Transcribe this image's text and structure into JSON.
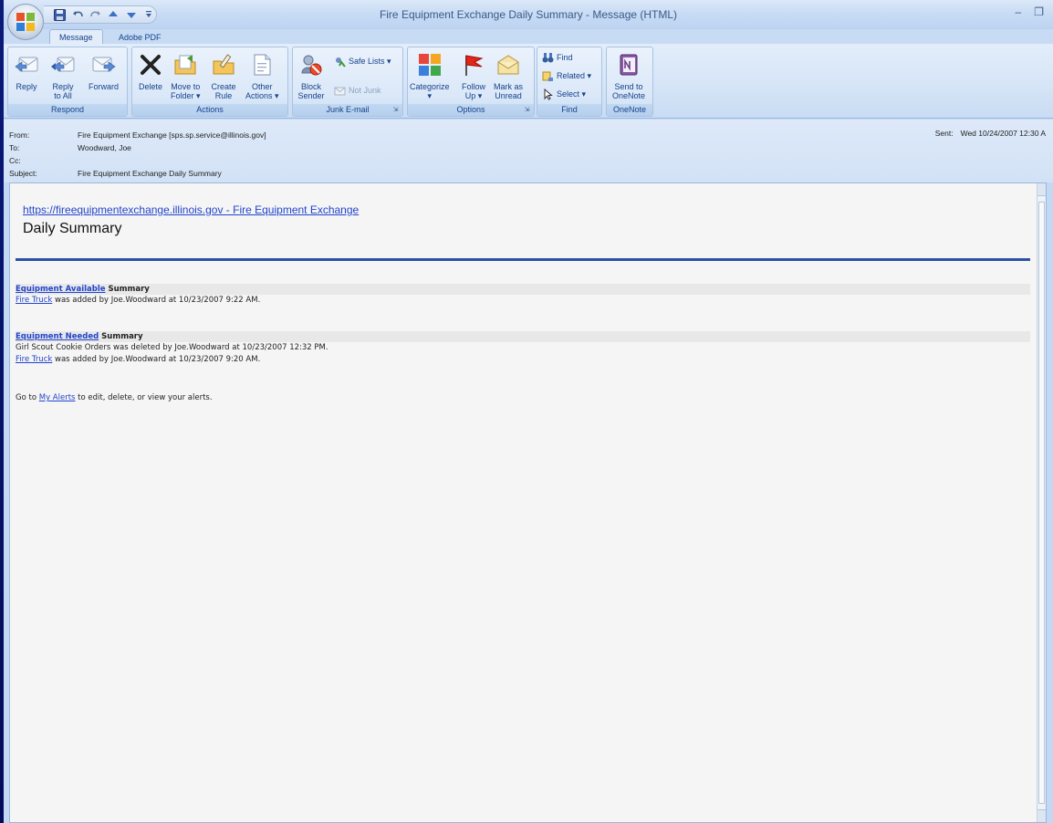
{
  "window": {
    "title": "Fire Equipment Exchange Daily Summary - Message (HTML)",
    "minimize": "–",
    "restore": "❐"
  },
  "tabs": [
    "Message",
    "Adobe PDF"
  ],
  "ribbon": {
    "respond": {
      "label": "Respond",
      "reply": "Reply",
      "reply_all": "Reply\nto All",
      "forward": "Forward"
    },
    "actions": {
      "label": "Actions",
      "delete": "Delete",
      "move": "Move to\nFolder ▾",
      "create_rule": "Create\nRule",
      "other": "Other\nActions ▾"
    },
    "junk": {
      "label": "Junk E-mail",
      "block": "Block\nSender",
      "safe_lists": "Safe Lists ▾",
      "not_junk": "Not Junk"
    },
    "options": {
      "label": "Options",
      "categorize": "Categorize\n▾",
      "follow_up": "Follow\nUp ▾",
      "mark_unread": "Mark as\nUnread"
    },
    "find": {
      "label": "Find",
      "find": "Find",
      "related": "Related ▾",
      "select": "Select ▾"
    },
    "onenote": {
      "label": "OneNote",
      "send": "Send to\nOneNote"
    }
  },
  "header": {
    "from_label": "From:",
    "from_value": "Fire Equipment Exchange [sps.sp.service@illinois.gov]",
    "to_label": "To:",
    "to_value": "Woodward, Joe",
    "cc_label": "Cc:",
    "cc_value": "",
    "subject_label": "Subject:",
    "subject_value": "Fire Equipment Exchange Daily Summary",
    "sent_label": "Sent:",
    "sent_value": "Wed 10/24/2007 12:30 A"
  },
  "body": {
    "site_link": "https://fireequipmentexchange.illinois.gov - Fire Equipment Exchange",
    "title": "Daily Summary",
    "available": {
      "link": "Equipment Available",
      "suffix": " Summary",
      "lines": [
        {
          "link": "Fire Truck",
          "text": " was added by Joe.Woodward at 10/23/2007 9:22 AM."
        }
      ]
    },
    "needed": {
      "link": "Equipment Needed",
      "suffix": " Summary",
      "line1": "Girl Scout Cookie Orders was deleted by Joe.Woodward at 10/23/2007 12:32 PM.",
      "line2_link": "Fire Truck",
      "line2_text": " was added by Joe.Woodward at 10/23/2007 9:20 AM."
    },
    "alerts": {
      "prefix": "Go to ",
      "link": "My Alerts",
      "suffix": " to edit, delete, or view your alerts."
    }
  }
}
